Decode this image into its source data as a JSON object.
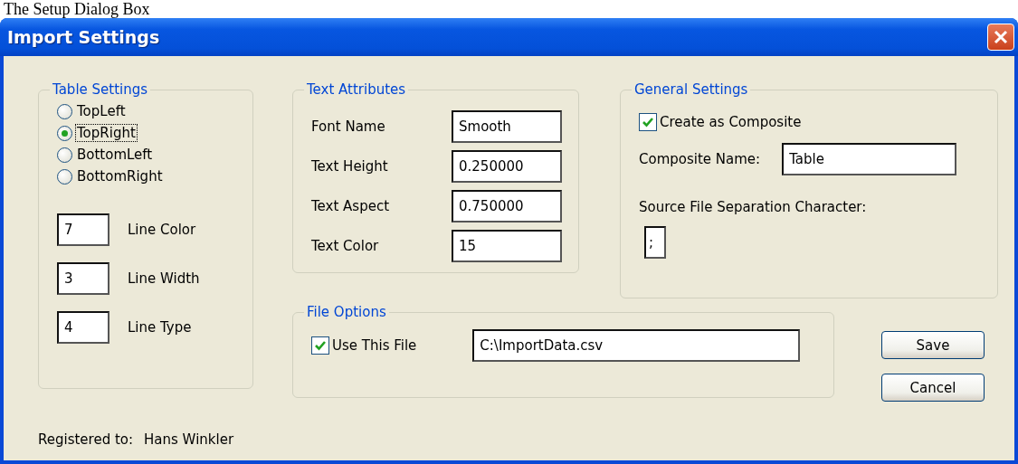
{
  "caption": "The Setup Dialog Box",
  "window": {
    "title": "Import Settings"
  },
  "table_settings": {
    "title": "Table Settings",
    "anchors": [
      {
        "label": "TopLeft",
        "selected": false,
        "focused": false
      },
      {
        "label": "TopRight",
        "selected": true,
        "focused": true
      },
      {
        "label": "BottomLeft",
        "selected": false,
        "focused": false
      },
      {
        "label": "BottomRight",
        "selected": false,
        "focused": false
      }
    ],
    "fields": [
      {
        "value": "7",
        "label": "Line Color"
      },
      {
        "value": "3",
        "label": "Line Width"
      },
      {
        "value": "4",
        "label": "Line Type"
      }
    ]
  },
  "text_attributes": {
    "title": "Text Attributes",
    "fields": [
      {
        "label": "Font Name",
        "value": "Smooth"
      },
      {
        "label": "Text Height",
        "value": "0.250000"
      },
      {
        "label": "Text Aspect",
        "value": "0.750000"
      },
      {
        "label": "Text Color",
        "value": "15"
      }
    ]
  },
  "general_settings": {
    "title": "General Settings",
    "create_composite": {
      "label": "Create as Composite",
      "checked": true
    },
    "composite_name": {
      "label": "Composite Name:",
      "value": "Table"
    },
    "separator": {
      "label": "Source File Separation Character:",
      "value": ";"
    }
  },
  "file_options": {
    "title": "File Options",
    "use_file": {
      "label": "Use This File",
      "checked": true
    },
    "path": "C:\\ImportData.csv"
  },
  "buttons": [
    "Save",
    "Cancel"
  ],
  "footer": {
    "label": "Registered to:",
    "name": "Hans Winkler"
  }
}
